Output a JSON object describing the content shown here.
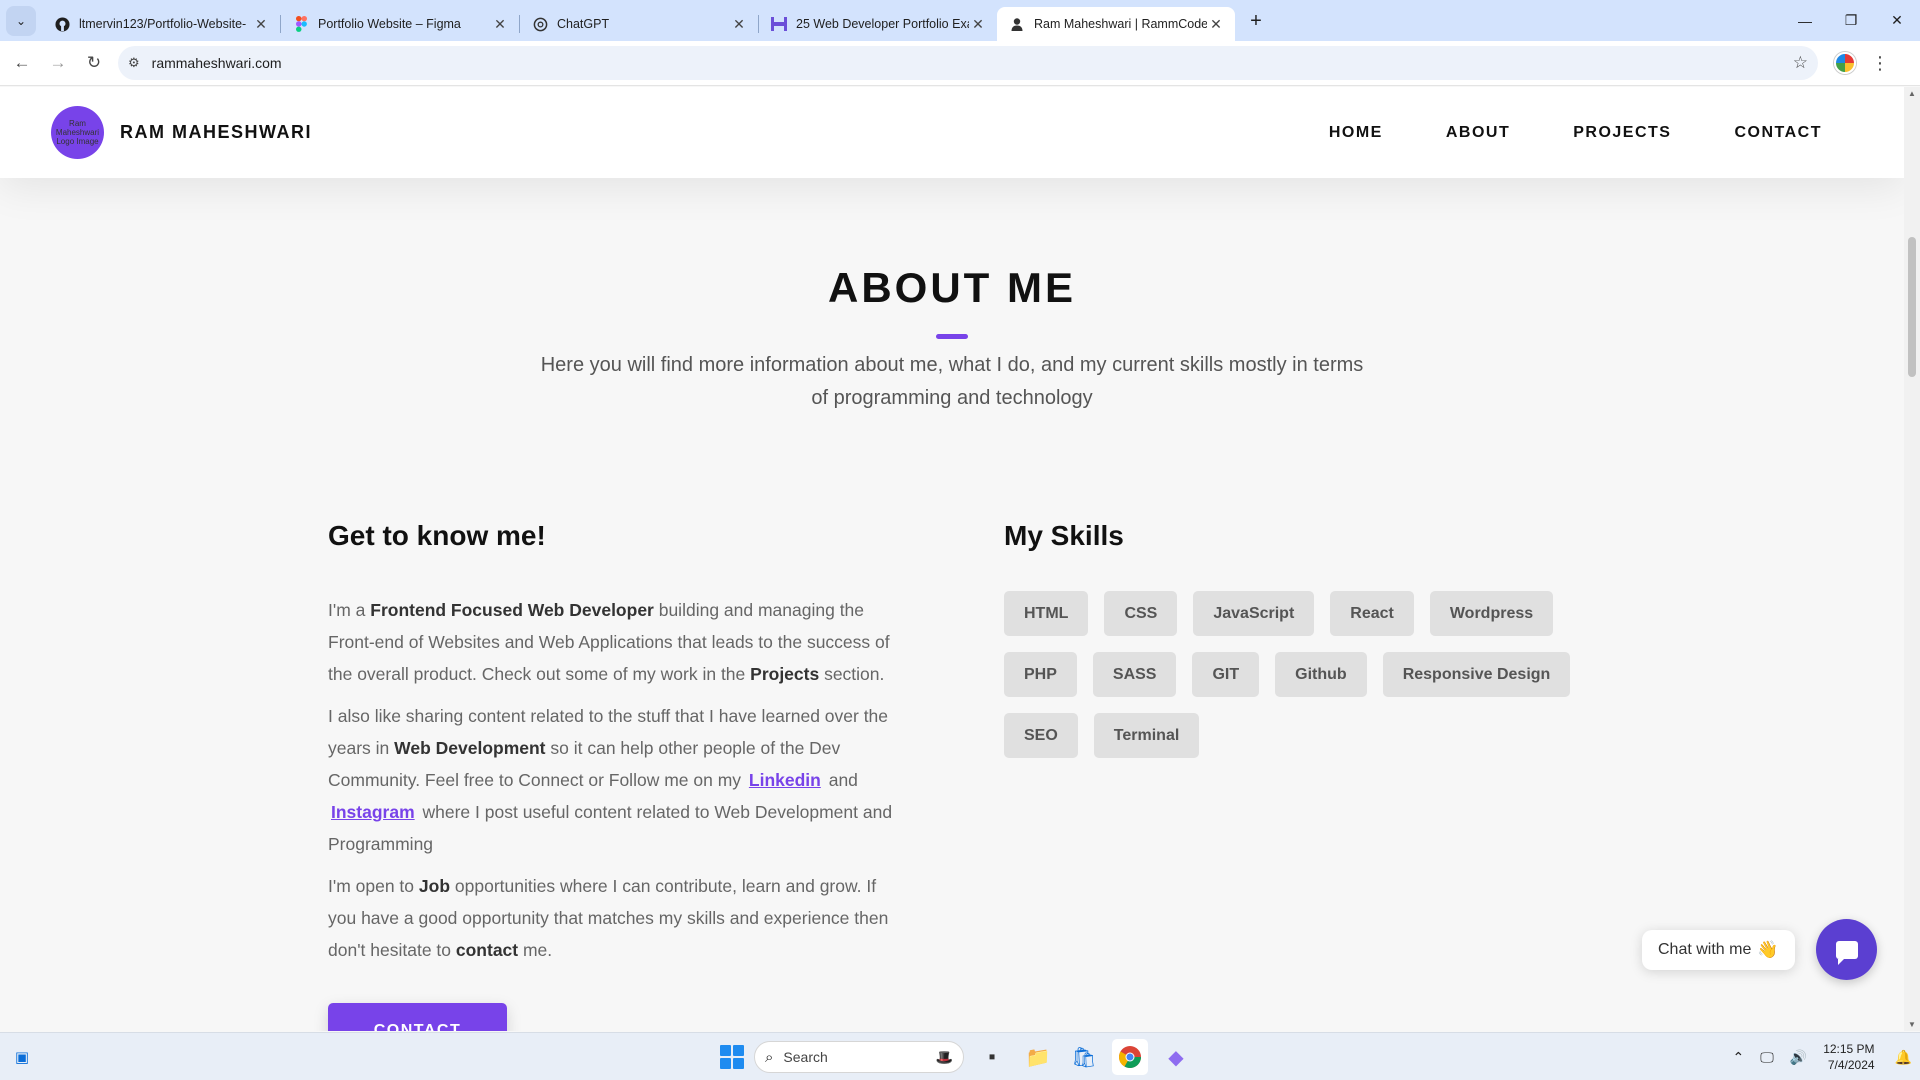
{
  "browser": {
    "tabs": [
      {
        "title": "ltmervin123/Portfolio-Website-",
        "favicon": "github-icon",
        "active": false
      },
      {
        "title": "Portfolio Website – Figma",
        "favicon": "figma-icon",
        "active": false
      },
      {
        "title": "ChatGPT",
        "favicon": "chatgpt-icon",
        "active": false
      },
      {
        "title": "25 Web Developer Portfolio Exa",
        "favicon": "webflow-icon",
        "active": false
      },
      {
        "title": "Ram Maheshwari | RammCodes",
        "favicon": "user-icon",
        "active": true
      }
    ],
    "url": "rammaheshwari.com"
  },
  "site": {
    "logo_alt": "Ram Maheshwari Logo Image",
    "name": "RAM MAHESHWARI",
    "nav": [
      "HOME",
      "ABOUT",
      "PROJECTS",
      "CONTACT"
    ],
    "accent_color": "#7843e9"
  },
  "about": {
    "heading": "ABOUT ME",
    "subtitle": "Here you will find more information about me, what I do, and my current skills mostly in terms of programming and technology",
    "know_title": "Get to know me!",
    "p1": {
      "a": "I'm a ",
      "b": "Frontend Focused Web Developer",
      "c": " building and managing the Front-end of Websites and Web Applications that leads to the success of the overall product. Check out some of my work in the ",
      "d": "Projects",
      "e": " section."
    },
    "p2": {
      "a": "I also like sharing content related to the stuff that I have learned over the years in ",
      "b": "Web Development",
      "c": " so it can help other people of the Dev Community. Feel free to Connect or Follow me on my ",
      "link1": "Linkedin",
      "d": " and ",
      "link2": "Instagram",
      "e": " where I post useful content related to Web Development and Programming"
    },
    "p3": {
      "a": "I'm open to ",
      "b": "Job",
      "c": " opportunities where I can contribute, learn and grow. If you have a good opportunity that matches my skills and experience then don't hesitate to ",
      "d": "contact",
      "e": " me."
    },
    "contact_button": "CONTACT",
    "skills_title": "My Skills",
    "skills": [
      "HTML",
      "CSS",
      "JavaScript",
      "React",
      "Wordpress",
      "PHP",
      "SASS",
      "GIT",
      "Github",
      "Responsive Design",
      "SEO",
      "Terminal"
    ]
  },
  "chat": {
    "label": "Chat with me",
    "emoji": "👋"
  },
  "taskbar": {
    "search_placeholder": "Search",
    "time": "12:15 PM",
    "date": "7/4/2024"
  }
}
